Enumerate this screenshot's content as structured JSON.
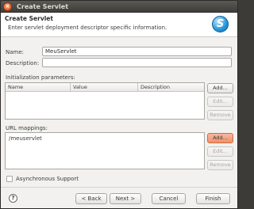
{
  "window": {
    "title": "Create Servlet",
    "close_glyph": "×"
  },
  "header": {
    "title": "Create Servlet",
    "description": "Enter servlet deployment descriptor specific information.",
    "icon": "servlet-wizard-icon",
    "icon_glyph": "S"
  },
  "form": {
    "name_label": "Name:",
    "name_value": "MeuServlet",
    "description_label": "Description:",
    "description_value": ""
  },
  "init_params": {
    "label": "Initialization parameters:",
    "columns": [
      "Name",
      "Value",
      "Description"
    ],
    "rows": [],
    "add_label": "Add...",
    "edit_label": "Edit...",
    "remove_label": "Remove"
  },
  "url_mappings": {
    "label": "URL mappings:",
    "items": [
      "/meuservlet"
    ],
    "add_label": "Add...",
    "edit_label": "Edit...",
    "remove_label": "Remove"
  },
  "async": {
    "label": "Asynchronous Support",
    "checked": false
  },
  "footer": {
    "help_glyph": "?",
    "back_label": "< Back",
    "next_label": "Next >",
    "cancel_label": "Cancel",
    "finish_label": "Finish"
  },
  "colors": {
    "accent": "#f0906a",
    "wizard_icon": "#2596d8",
    "titlebar": "#3e3d39"
  }
}
